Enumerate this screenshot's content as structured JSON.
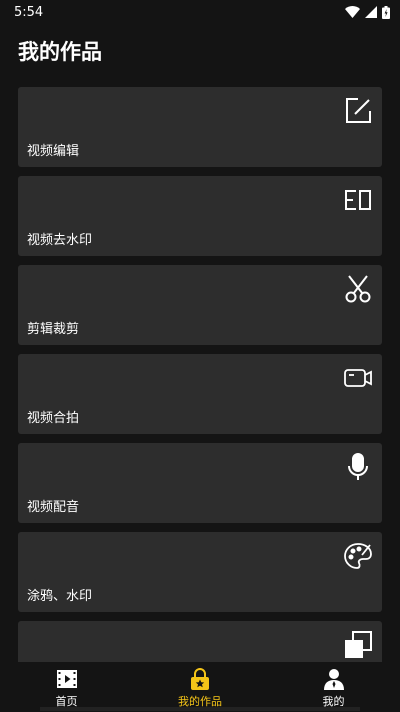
{
  "status_bar": {
    "time": "5:54"
  },
  "header": {
    "title": "我的作品"
  },
  "cards": [
    {
      "label": "视频编辑",
      "icon": "edit-icon"
    },
    {
      "label": "视频去水印",
      "icon": "watermark-remove-icon"
    },
    {
      "label": "剪辑裁剪",
      "icon": "scissors-icon"
    },
    {
      "label": "视频合拍",
      "icon": "video-camera-icon"
    },
    {
      "label": "视频配音",
      "icon": "microphone-icon"
    },
    {
      "label": "涂鸦、水印",
      "icon": "palette-icon"
    },
    {
      "label": "",
      "icon": "copy-icon"
    }
  ],
  "bottom_nav": {
    "items": [
      {
        "label": "首页",
        "icon": "film-icon",
        "active": false
      },
      {
        "label": "我的作品",
        "icon": "lock-star-icon",
        "active": true
      },
      {
        "label": "我的",
        "icon": "person-icon",
        "active": false
      }
    ]
  },
  "colors": {
    "accent": "#f5c518",
    "card_bg": "#2d2d2d",
    "page_bg": "#141414"
  }
}
